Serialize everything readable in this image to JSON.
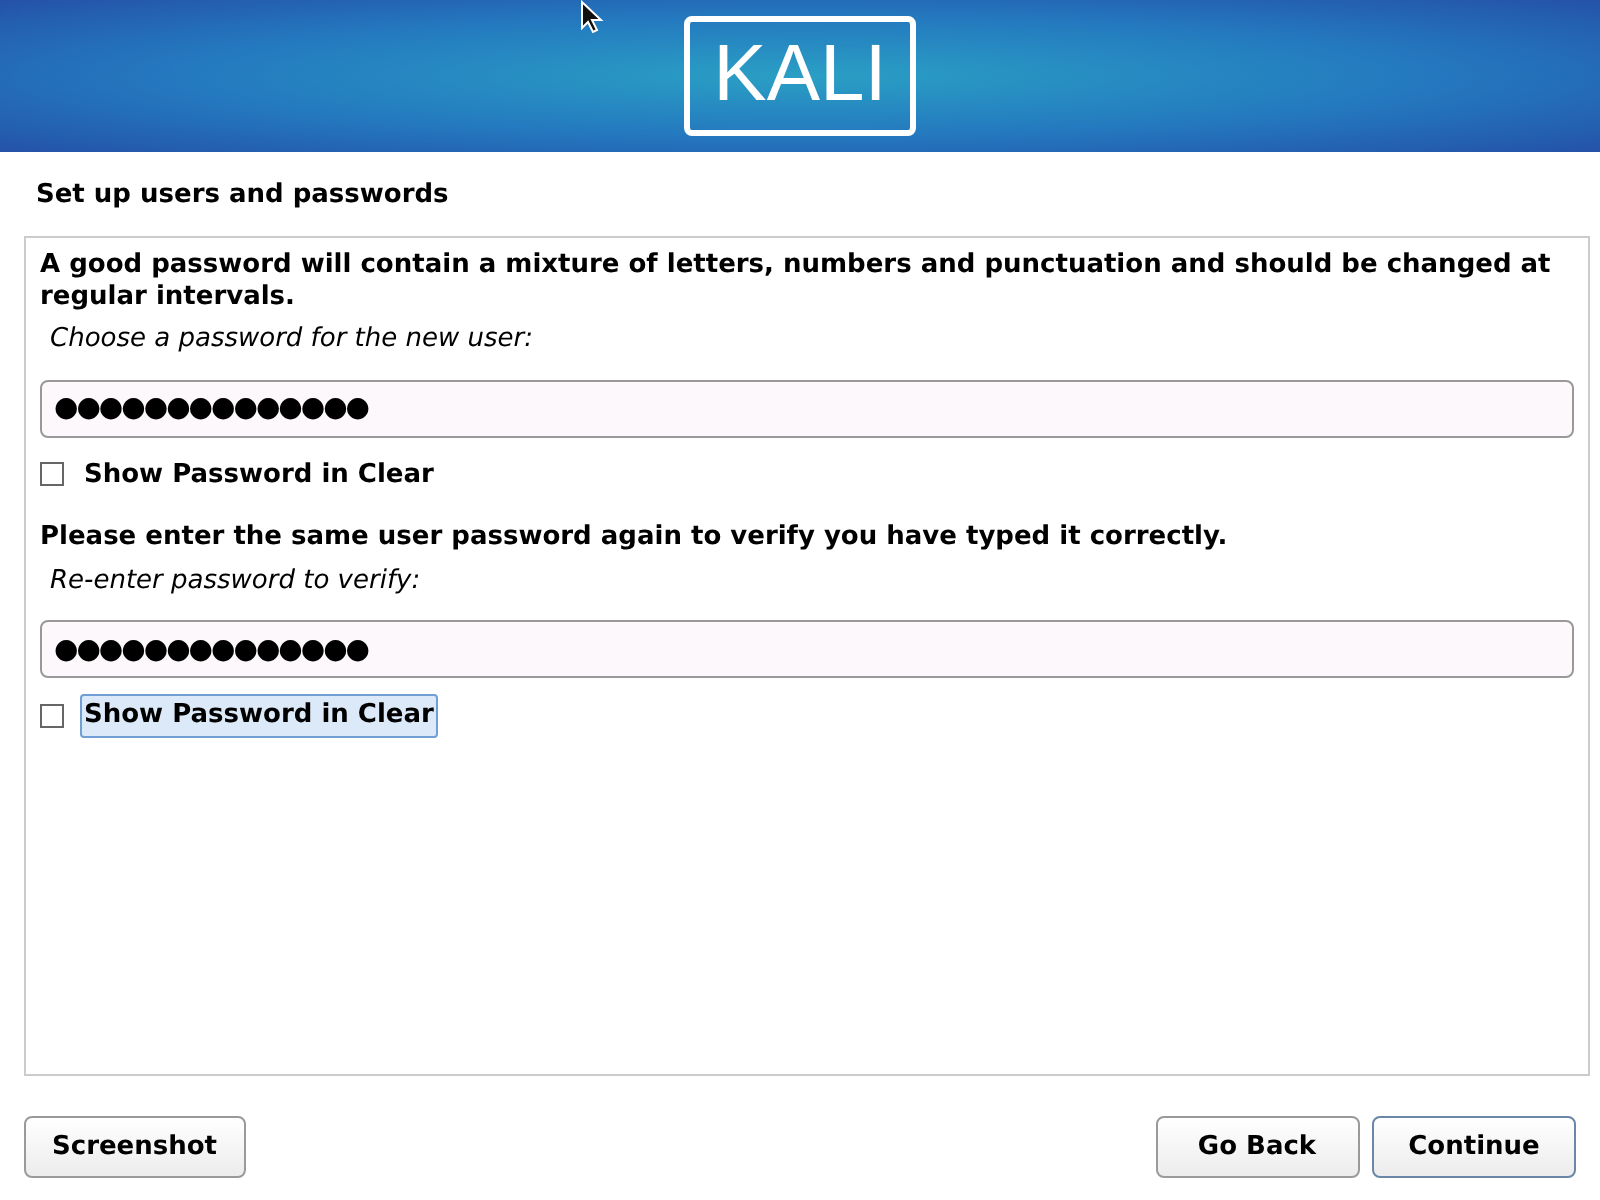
{
  "banner": {
    "logo": "KALI"
  },
  "title": "Set up users and passwords",
  "sections": [
    {
      "description": "A good password will contain a mixture of letters, numbers and punctuation and should be changed at regular intervals.",
      "prompt": "Choose a password for the new user:",
      "value": "●●●●●●●●●●●●●●",
      "show_clear": {
        "label": "Show Password in Clear",
        "checked": false,
        "focused": false
      }
    },
    {
      "description": "Please enter the same user password again to verify you have typed it correctly.",
      "prompt": "Re-enter password to verify:",
      "value": "●●●●●●●●●●●●●●",
      "show_clear": {
        "label": "Show Password in Clear",
        "checked": false,
        "focused": true
      }
    }
  ],
  "buttons": {
    "left": [
      "Screenshot"
    ],
    "right": [
      {
        "label": "Go Back",
        "default": false
      },
      {
        "label": "Continue",
        "default": true
      }
    ]
  }
}
